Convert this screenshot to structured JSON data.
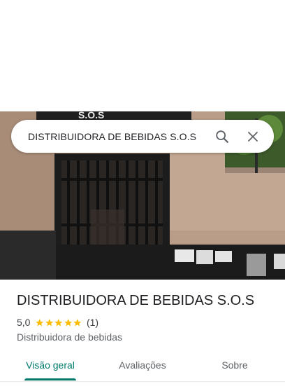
{
  "search": {
    "query": "DISTRIBUIDORA DE BEBIDAS S.O.S"
  },
  "place": {
    "name": "DISTRIBUIDORA DE BEBIDAS S.O.S",
    "rating": "5,0",
    "stars": 5,
    "review_count": "(1)",
    "category": "Distribuidora de bebidas"
  },
  "tabs": [
    {
      "label": "Visão geral",
      "active": true
    },
    {
      "label": "Avaliações",
      "active": false
    },
    {
      "label": "Sobre",
      "active": false
    }
  ],
  "icons": {
    "search": "search-icon",
    "close": "close-icon",
    "star": "star-icon"
  },
  "colors": {
    "accent": "#00796b",
    "star": "#fbbc04"
  },
  "photo": {
    "sign_text": "S.O.S"
  }
}
